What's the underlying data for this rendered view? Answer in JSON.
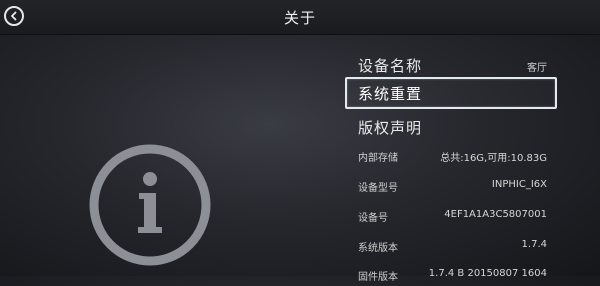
{
  "header": {
    "title": "关于",
    "back_icon": "back-arrow-icon"
  },
  "hero": {
    "icon": "info-icon"
  },
  "menu": [
    {
      "label": "设备名称",
      "value": "客厅"
    },
    {
      "label": "系统重置",
      "value": "",
      "selected": true
    },
    {
      "label": "版权声明",
      "value": ""
    }
  ],
  "info": [
    {
      "label": "内部存储",
      "value": "总共:16G,可用:10.83G"
    },
    {
      "label": "设备型号",
      "value": "INPHIC_I6X"
    },
    {
      "label": "设备号",
      "value": "4EF1A1A3C5807001"
    },
    {
      "label": "系统版本",
      "value": "1.7.4"
    },
    {
      "label": "固件版本",
      "value": "1.7.4 B 20150807 1604"
    }
  ],
  "colors": {
    "background": "#26272d",
    "selection_border": "#e6e8ea"
  }
}
